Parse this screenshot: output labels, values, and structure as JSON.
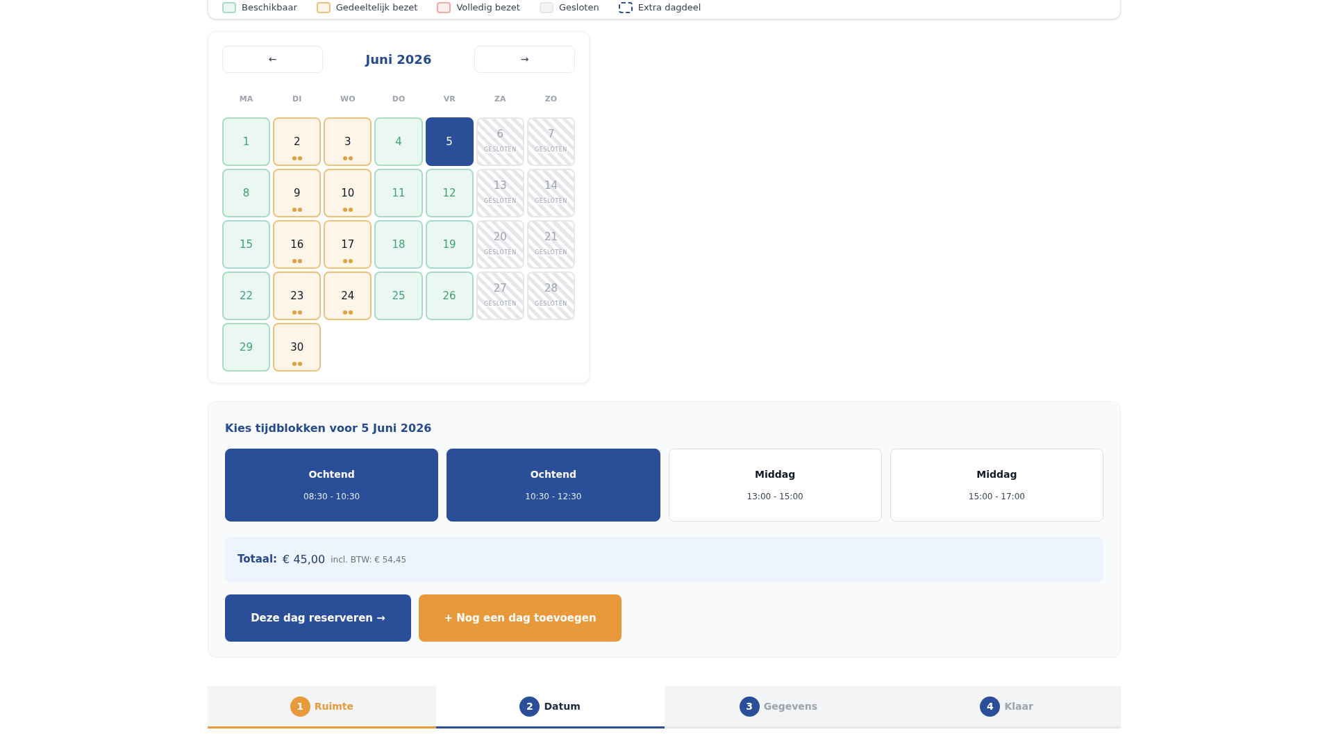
{
  "legend": [
    {
      "kind": "available",
      "label": "Beschikbaar"
    },
    {
      "kind": "partial",
      "label": "Gedeeltelijk bezet"
    },
    {
      "kind": "full",
      "label": "Volledig bezet"
    },
    {
      "kind": "closed",
      "label": "Gesloten"
    },
    {
      "kind": "extra",
      "label": "Extra dagdeel"
    }
  ],
  "calendar": {
    "prev": "←",
    "title": "Juni 2026",
    "next": "→",
    "weekdays": [
      "MA",
      "DI",
      "WO",
      "DO",
      "VR",
      "ZA",
      "ZO"
    ],
    "days": [
      {
        "day": "1",
        "kind": "available",
        "selected": false
      },
      {
        "day": "2",
        "kind": "partial",
        "selected": false
      },
      {
        "day": "3",
        "kind": "partial",
        "selected": false
      },
      {
        "day": "4",
        "kind": "available",
        "selected": false
      },
      {
        "day": "5",
        "kind": "available",
        "selected": true
      },
      {
        "day": "6",
        "kind": "closed",
        "note": "GESLOTEN",
        "selected": false
      },
      {
        "day": "7",
        "kind": "closed",
        "note": "GESLOTEN",
        "selected": false
      },
      {
        "day": "8",
        "kind": "available",
        "selected": false
      },
      {
        "day": "9",
        "kind": "partial",
        "selected": false
      },
      {
        "day": "10",
        "kind": "partial",
        "selected": false
      },
      {
        "day": "11",
        "kind": "available",
        "selected": false
      },
      {
        "day": "12",
        "kind": "available",
        "selected": false
      },
      {
        "day": "13",
        "kind": "closed",
        "note": "GESLOTEN",
        "selected": false
      },
      {
        "day": "14",
        "kind": "closed",
        "note": "GESLOTEN",
        "selected": false
      },
      {
        "day": "15",
        "kind": "available",
        "selected": false
      },
      {
        "day": "16",
        "kind": "partial",
        "selected": false
      },
      {
        "day": "17",
        "kind": "partial",
        "selected": false
      },
      {
        "day": "18",
        "kind": "available",
        "selected": false
      },
      {
        "day": "19",
        "kind": "available",
        "selected": false
      },
      {
        "day": "20",
        "kind": "closed",
        "note": "GESLOTEN",
        "selected": false
      },
      {
        "day": "21",
        "kind": "closed",
        "note": "GESLOTEN",
        "selected": false
      },
      {
        "day": "22",
        "kind": "available",
        "selected": false
      },
      {
        "day": "23",
        "kind": "partial",
        "selected": false
      },
      {
        "day": "24",
        "kind": "partial",
        "selected": false
      },
      {
        "day": "25",
        "kind": "available",
        "selected": false
      },
      {
        "day": "26",
        "kind": "available",
        "selected": false
      },
      {
        "day": "27",
        "kind": "closed",
        "note": "GESLOTEN",
        "selected": false
      },
      {
        "day": "28",
        "kind": "closed",
        "note": "GESLOTEN",
        "selected": false
      },
      {
        "day": "29",
        "kind": "available",
        "selected": false
      },
      {
        "day": "30",
        "kind": "partial",
        "selected": false
      }
    ]
  },
  "timeblocks": {
    "title": "Kies tijdblokken voor 5 Juni 2026",
    "blocks": [
      {
        "name": "Ochtend",
        "time": "08:30 - 10:30",
        "selected": true
      },
      {
        "name": "Ochtend",
        "time": "10:30 - 12:30",
        "selected": true
      },
      {
        "name": "Middag",
        "time": "13:00 - 15:00",
        "selected": false
      },
      {
        "name": "Middag",
        "time": "15:00 - 17:00",
        "selected": false
      }
    ]
  },
  "total": {
    "label": "Totaal:",
    "amount": "€ 45,00",
    "vat": "incl. BTW: € 54,45"
  },
  "buttons": [
    {
      "kind": "primary",
      "label": "Deze dag reserveren →"
    },
    {
      "kind": "secondary",
      "label": "+ Nog een dag toevoegen"
    }
  ],
  "steps": [
    {
      "number": "1",
      "label": "Ruimte",
      "done": true,
      "selected": false
    },
    {
      "number": "2",
      "label": "Datum",
      "done": false,
      "selected": true
    },
    {
      "number": "3",
      "label": "Gegevens",
      "done": false,
      "selected": false
    },
    {
      "number": "4",
      "label": "Klaar",
      "done": false,
      "selected": false
    }
  ]
}
